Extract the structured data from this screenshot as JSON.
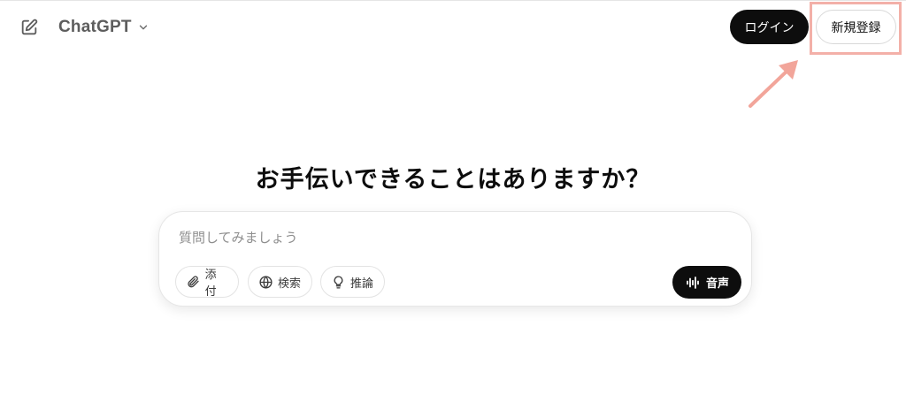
{
  "header": {
    "model_name": "ChatGPT",
    "login_label": "ログイン",
    "signup_label": "新規登録"
  },
  "hero": {
    "title": "お手伝いできることはありますか？"
  },
  "composer": {
    "placeholder": "質問してみましょう",
    "value": "",
    "tools": [
      {
        "label": "添付",
        "icon": "paperclip-icon"
      },
      {
        "label": "検索",
        "icon": "globe-icon"
      },
      {
        "label": "推論",
        "icon": "lightbulb-icon"
      }
    ],
    "voice_label": "音声"
  },
  "annotation": {
    "highlight_color": "#f3b0a8",
    "arrow_color": "#f2a59a"
  }
}
